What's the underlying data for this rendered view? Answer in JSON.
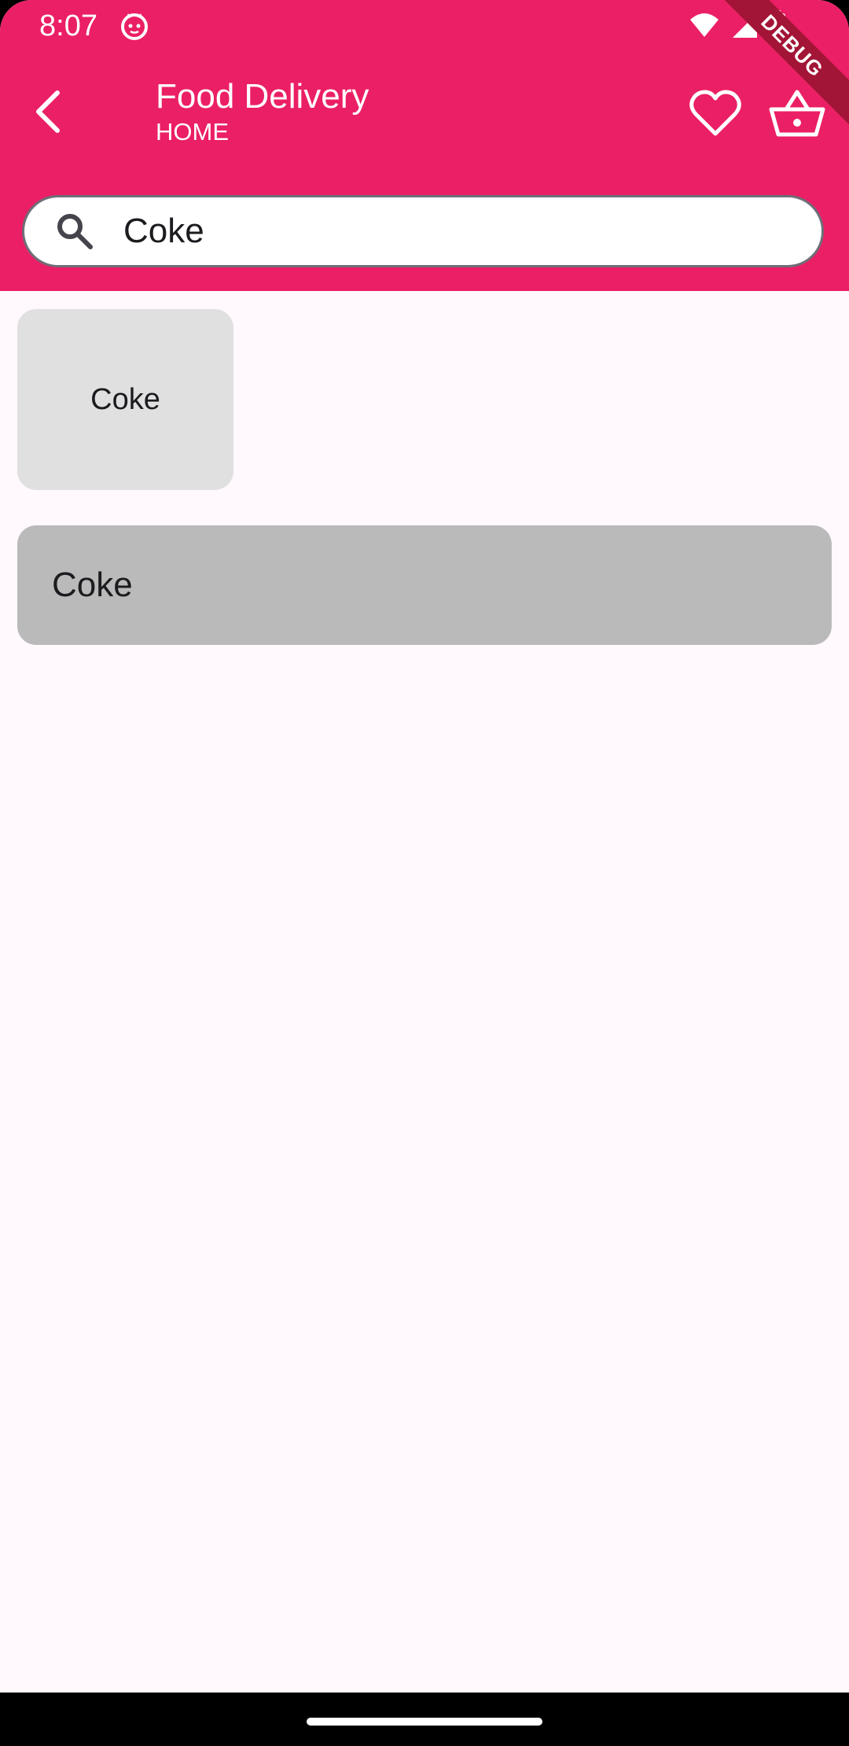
{
  "status_bar": {
    "time": "8:07",
    "app_icon": "cat-face-icon",
    "icons": [
      "wifi-icon",
      "cell-signal-icon",
      "battery-icon"
    ]
  },
  "debug_banner": {
    "label": "DEBUG"
  },
  "app_bar": {
    "title": "Food Delivery",
    "subtitle": "HOME",
    "back_icon": "chevron-left-icon",
    "actions": [
      "heart-outline-icon",
      "shopping-basket-icon"
    ]
  },
  "search": {
    "icon": "search-icon",
    "value": "Coke",
    "placeholder": ""
  },
  "results": {
    "tile_label": "Coke",
    "row_label": "Coke"
  },
  "colors": {
    "primary": "#EB1F65",
    "background": "#FFF8FD",
    "tile": "#E0E0E0",
    "row": "#BABABA",
    "debug_ribbon": "#A31536"
  }
}
